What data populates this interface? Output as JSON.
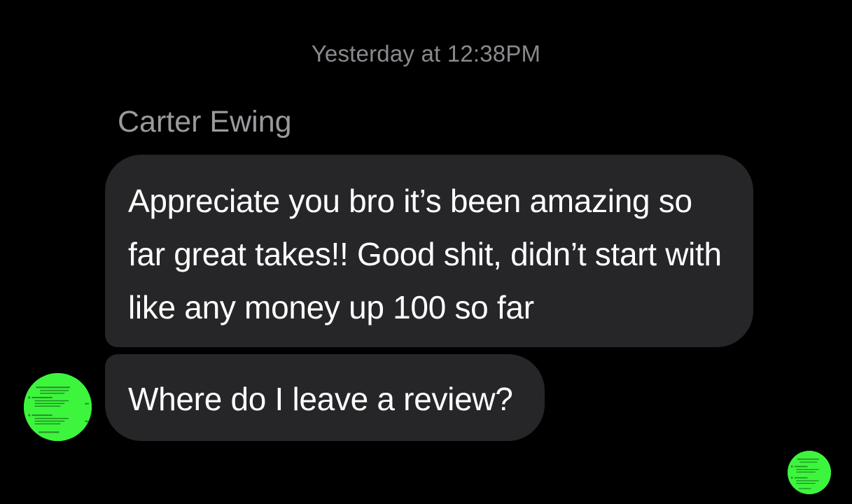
{
  "conversation": {
    "timestamp": "Yesterday at 12:38PM",
    "sender_name": "Carter Ewing",
    "messages": [
      {
        "text": "Appreciate you bro it’s been amazing so far great takes!! Good shit, didn’t start with like any money up 100 so far"
      },
      {
        "text": "Where do I leave a review?"
      }
    ]
  },
  "colors": {
    "background": "#000000",
    "bubble": "#262628",
    "timestamp_text": "#8a8a8e",
    "sender_text": "#9a9a9e",
    "avatar_green": "#3df53d"
  },
  "icons": {
    "sender_avatar": "avatar-thumbnail",
    "self_avatar": "avatar-thumbnail"
  }
}
